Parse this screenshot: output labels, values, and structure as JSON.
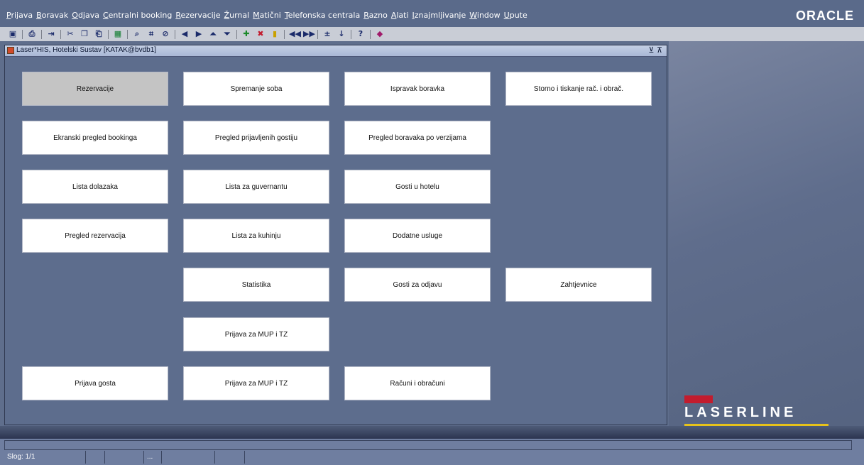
{
  "menu": {
    "items": [
      "Prijava",
      "Boravak",
      "Odjava",
      "Centralni booking",
      "Rezervacije",
      "Žurnal",
      "Matični",
      "Telefonska centrala",
      "Razno",
      "Alati",
      "Iznajmljivanje",
      "Window",
      "Upute"
    ],
    "brand": "ORACLE"
  },
  "toolbar": {
    "icons": [
      "save-icon",
      "print-icon",
      "exit-icon",
      "cut-icon",
      "copy-icon",
      "paste-icon",
      "excel-icon",
      "query-icon",
      "execute-query-icon",
      "cancel-query-icon",
      "prev-record-icon",
      "next-record-icon",
      "first-record-icon",
      "last-record-icon",
      "insert-record-icon",
      "delete-record-icon",
      "lock-record-icon",
      "prev-block-icon",
      "next-block-icon",
      "clear-icon",
      "down-icon",
      "help-icon",
      "bookmark-icon"
    ]
  },
  "window": {
    "title": "Laser*HIS, Hotelski Sustav  [KATAK@bvdb1]",
    "controls": "⊻ ⊼"
  },
  "buttons": {
    "rezervacije": "Rezervacije",
    "spremanje_soba": "Spremanje soba",
    "ispravak_boravka": "Ispravak boravka",
    "storno": "Storno i tiskanje rač. i obrač.",
    "ekranski_pregled": "Ekranski pregled bookinga",
    "pregled_prijavljenih": "Pregled prijavljenih gostiju",
    "pregled_boravaka": "Pregled boravaka po verzijama",
    "lista_dolazaka": "Lista dolazaka",
    "lista_guvernantu": "Lista za guvernantu",
    "gosti_u_hotelu": "Gosti u hotelu",
    "pregled_rezervacija": "Pregled rezervacija",
    "lista_kuhinju": "Lista za kuhinju",
    "dodatne_usluge": "Dodatne usluge",
    "statistika": "Statistika",
    "gosti_za_odjavu": "Gosti za odjavu",
    "zahtjevnice": "Zahtjevnice",
    "prijava_mup_1": "Prijava za MUP i TZ",
    "prijava_gosta": "Prijava gosta",
    "prijava_mup_2": "Prijava za MUP i TZ",
    "racuni": "Računi i obračuni"
  },
  "brand": {
    "laserline": "LASERLINE"
  },
  "status": {
    "record": "Slog: 1/1",
    "ellipsis": "..."
  }
}
